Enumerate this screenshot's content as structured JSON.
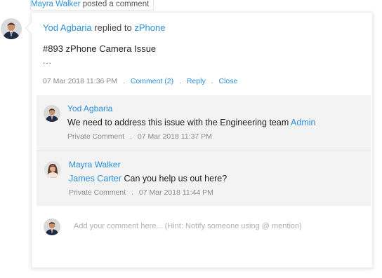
{
  "activity": {
    "actor": "Mayra Walker",
    "action": "posted a comment"
  },
  "post": {
    "author": "Yod Agbaria",
    "verb": "replied to",
    "target": "zPhone",
    "title": "#893 zPhone Camera Issue",
    "excerpt": "...",
    "timestamp": "07 Mar 2018 11:36 PM",
    "separator": ".",
    "actions": {
      "comment": "Comment (2)",
      "reply": "Reply",
      "close": "Close"
    }
  },
  "comments": [
    {
      "author": "Yod Agbaria",
      "text": "We need to address this issue with the Engineering team",
      "mention": "Admin",
      "visibility": "Private Comment",
      "timestamp": "07 Mar 2018 11:37 PM"
    },
    {
      "author": "Mayra Walker",
      "mention": "James Carter",
      "text": "Can you help us out here?",
      "visibility": "Private Comment",
      "timestamp": "07 Mar 2018 11:44 PM"
    }
  ],
  "composer": {
    "placeholder": "Add your comment here... (Hint: Notify someone using @ mention)"
  }
}
